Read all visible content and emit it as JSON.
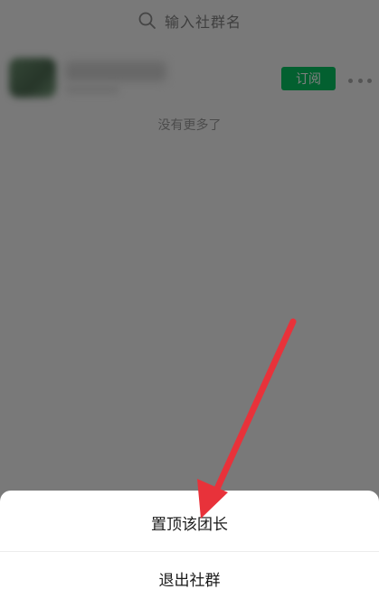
{
  "search": {
    "placeholder": "输入社群名"
  },
  "community": {
    "subscribe_label": "订阅"
  },
  "list": {
    "end_text": "没有更多了"
  },
  "action_sheet": {
    "items": [
      {
        "label": "置顶该团长"
      },
      {
        "label": "退出社群"
      }
    ]
  },
  "colors": {
    "subscribe_button": "#07c160",
    "annotation_arrow": "#e8323a"
  }
}
